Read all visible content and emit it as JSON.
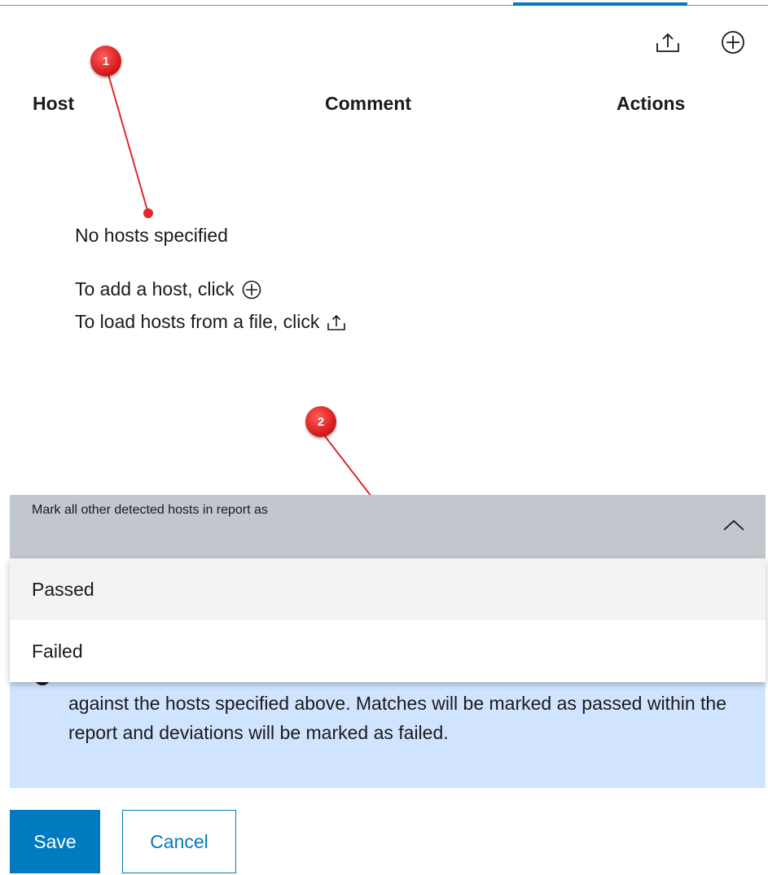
{
  "toolbar": {
    "upload_icon": "upload-icon",
    "add_icon": "add-circle-icon"
  },
  "table": {
    "columns": [
      "Host",
      "Comment",
      "Actions"
    ]
  },
  "empty_state": {
    "title": "No hosts specified",
    "add_hint": "To add a host, click",
    "load_hint": "To load hosts from a file, click"
  },
  "annotations": {
    "marker_1": "1",
    "marker_2": "2"
  },
  "report_dropdown": {
    "label": "Mark all other detected hosts in report as",
    "options": [
      "Passed",
      "Failed"
    ],
    "highlighted_option": "Passed",
    "expanded": true
  },
  "info": {
    "text": "against the hosts specified above. Matches will be marked as passed within the report and deviations will be marked as failed."
  },
  "footer": {
    "save_label": "Save",
    "cancel_label": "Cancel"
  },
  "colors": {
    "accent": "#007bc0",
    "dropdown_header_bg": "#c1c7cc",
    "info_bg": "#d1e4ff",
    "annotation_red": "#d51a1a"
  }
}
